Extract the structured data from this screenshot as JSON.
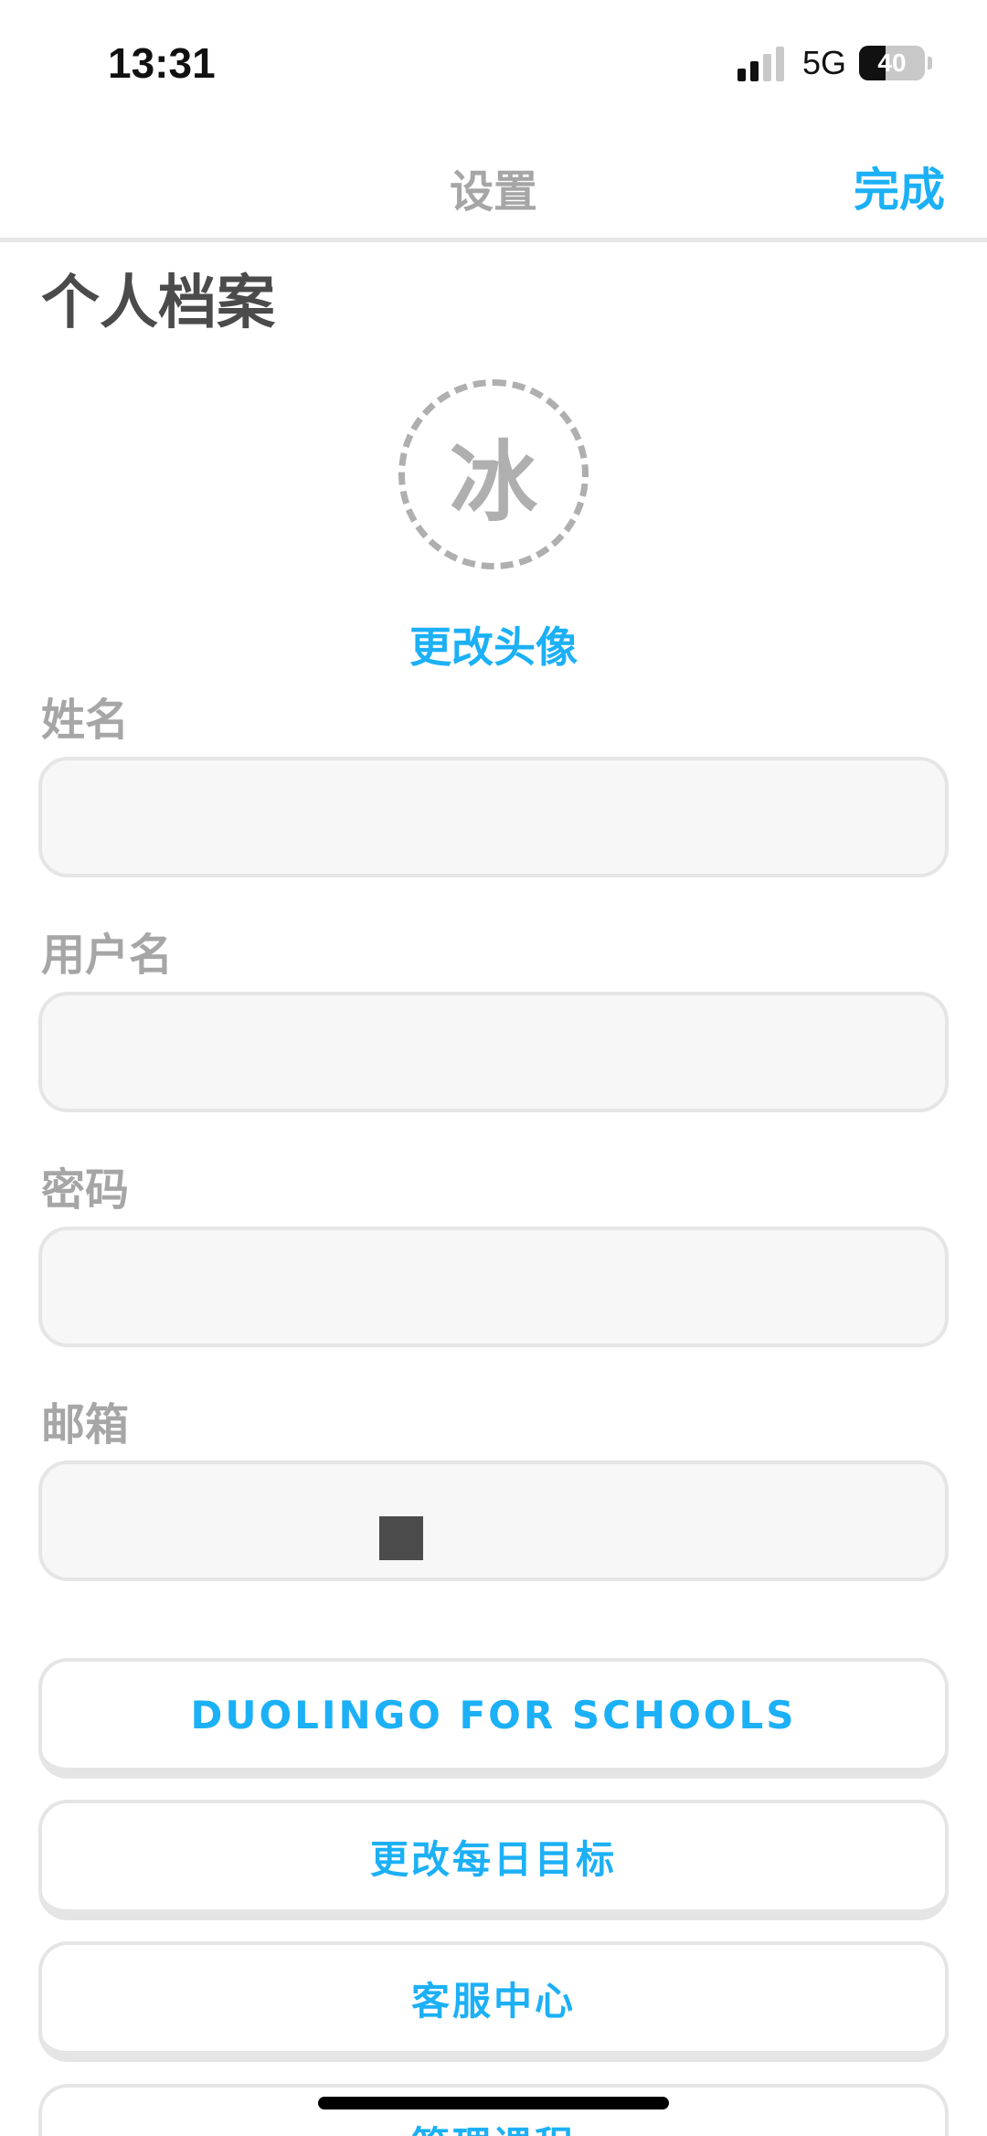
{
  "status_bar": {
    "time": "13:31",
    "network": "5G",
    "battery_percent": "40",
    "battery_level": 0.4
  },
  "header": {
    "title": "设置",
    "done_label": "完成"
  },
  "profile": {
    "section_title": "个人档案",
    "avatar_initial": "冰",
    "change_avatar_label": "更改头像"
  },
  "fields": {
    "name_label": "姓名",
    "name_value": "",
    "username_label": "用户名",
    "username_value": "",
    "password_label": "密码",
    "password_value": "",
    "email_label": "邮箱",
    "email_value": ""
  },
  "actions": {
    "schools_label": "DUOLINGO FOR SCHOOLS",
    "daily_goal_label": "更改每日目标",
    "help_center_label": "客服中心",
    "manage_courses_label": "管理课程"
  },
  "colors": {
    "accent": "#1cb0f6",
    "label_gray": "#a6a6a6",
    "title_dark": "#4b4b4b",
    "border": "#e5e5e5"
  }
}
